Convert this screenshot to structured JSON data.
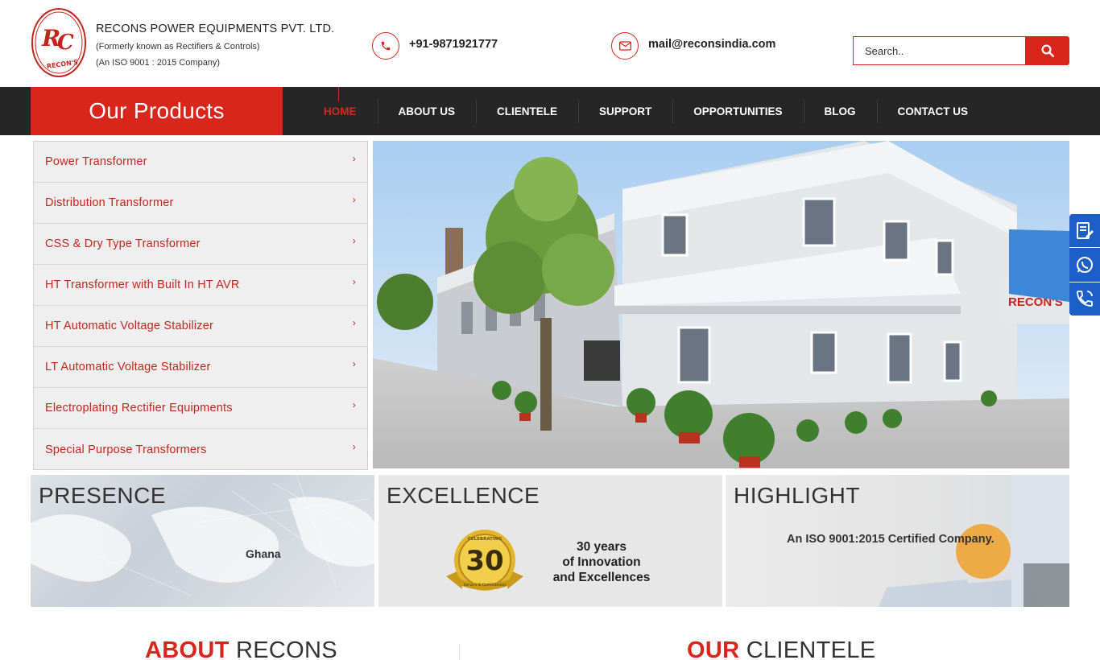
{
  "header": {
    "logo_text": "RC",
    "logo_subtext": "RECON'S",
    "company_name": "RECONS POWER EQUIPMENTS PVT. LTD.",
    "company_former": "(Formerly known as Rectifiers & Controls)",
    "company_iso": "(An ISO 9001 : 2015 Company)",
    "phone": "+91-9871921777",
    "email": "mail@reconsindia.com",
    "search_placeholder": "Search.."
  },
  "nav": {
    "products_title": "Our Products",
    "items": [
      {
        "label": "HOME",
        "active": true
      },
      {
        "label": "ABOUT US"
      },
      {
        "label": "CLIENTELE"
      },
      {
        "label": "SUPPORT"
      },
      {
        "label": "OPPORTUNITIES"
      },
      {
        "label": "BLOG"
      },
      {
        "label": "CONTACT US"
      }
    ]
  },
  "products": [
    {
      "label": "Power Transformer"
    },
    {
      "label": "Distribution Transformer"
    },
    {
      "label": "CSS & Dry Type Transformer"
    },
    {
      "label": "HT Transformer with Built In HT AVR"
    },
    {
      "label": "HT Automatic Voltage Stabilizer"
    },
    {
      "label": "LT Automatic Voltage Stabilizer"
    },
    {
      "label": "Electroplating Rectifier Equipments"
    },
    {
      "label": "Special Purpose Transformers"
    }
  ],
  "hero": {
    "building_sign": "RECON'S"
  },
  "cards": {
    "presence": {
      "title": "PRESENCE",
      "location": "Ghana"
    },
    "excellence": {
      "title": "EXCELLENCE",
      "badge_number": "30",
      "badge_top": "CELEBRATING",
      "badge_bottom": "Service & Commitment",
      "line1": "30 years",
      "line2": "of Innovation",
      "line3": "and Excellences"
    },
    "highlight": {
      "title": "HIGHLIGHT",
      "text": "An ISO 9001:2015 Certified Company."
    }
  },
  "sections": {
    "about_red": "ABOUT",
    "about_dark": "RECONS",
    "client_red": "OUR",
    "client_dark": "CLIENTELE"
  },
  "colors": {
    "brand_red": "#d9261c",
    "nav_dark": "#262626",
    "widget_blue": "#1c5fc7"
  },
  "icons": [
    "phone-icon",
    "mail-icon",
    "search-icon",
    "chevron-right-icon",
    "enquiry-icon",
    "whatsapp-icon",
    "call-icon"
  ]
}
